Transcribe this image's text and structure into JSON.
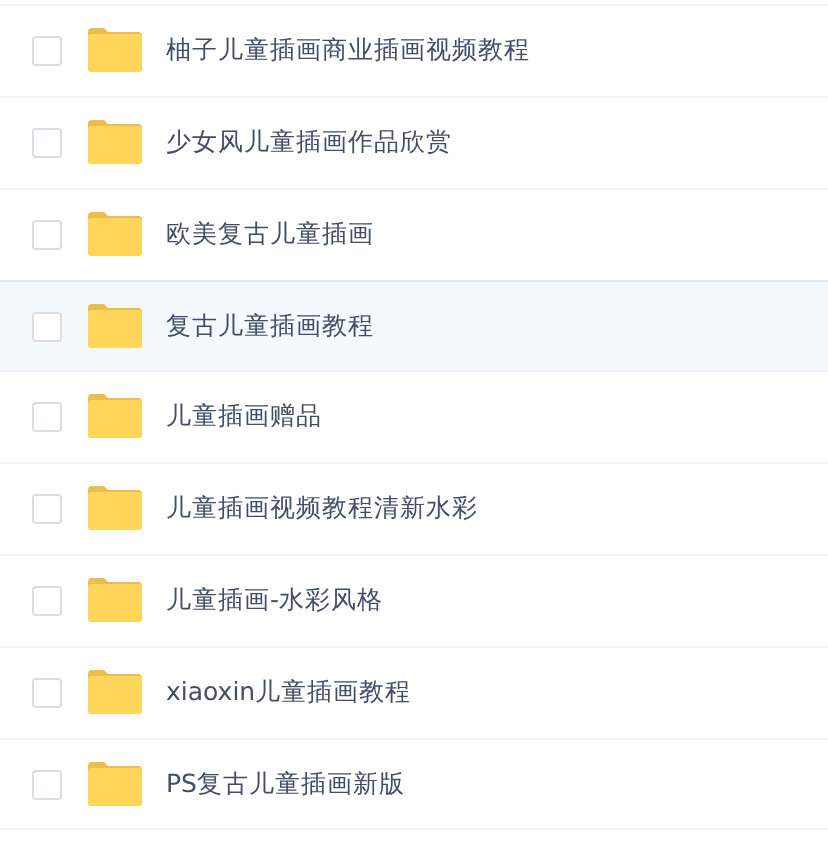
{
  "files": [
    {
      "name": "柚子儿童插画商业插画视频教程",
      "checked": false,
      "highlighted": false
    },
    {
      "name": "少女风儿童插画作品欣赏",
      "checked": false,
      "highlighted": false
    },
    {
      "name": "欧美复古儿童插画",
      "checked": false,
      "highlighted": false
    },
    {
      "name": "复古儿童插画教程",
      "checked": false,
      "highlighted": true
    },
    {
      "name": "儿童插画赠品",
      "checked": false,
      "highlighted": false
    },
    {
      "name": "儿童插画视频教程清新水彩",
      "checked": false,
      "highlighted": false
    },
    {
      "name": "儿童插画-水彩风格",
      "checked": false,
      "highlighted": false
    },
    {
      "name": "xiaoxin儿童插画教程",
      "checked": false,
      "highlighted": false
    },
    {
      "name": "PS复古儿童插画新版",
      "checked": false,
      "highlighted": false
    }
  ]
}
